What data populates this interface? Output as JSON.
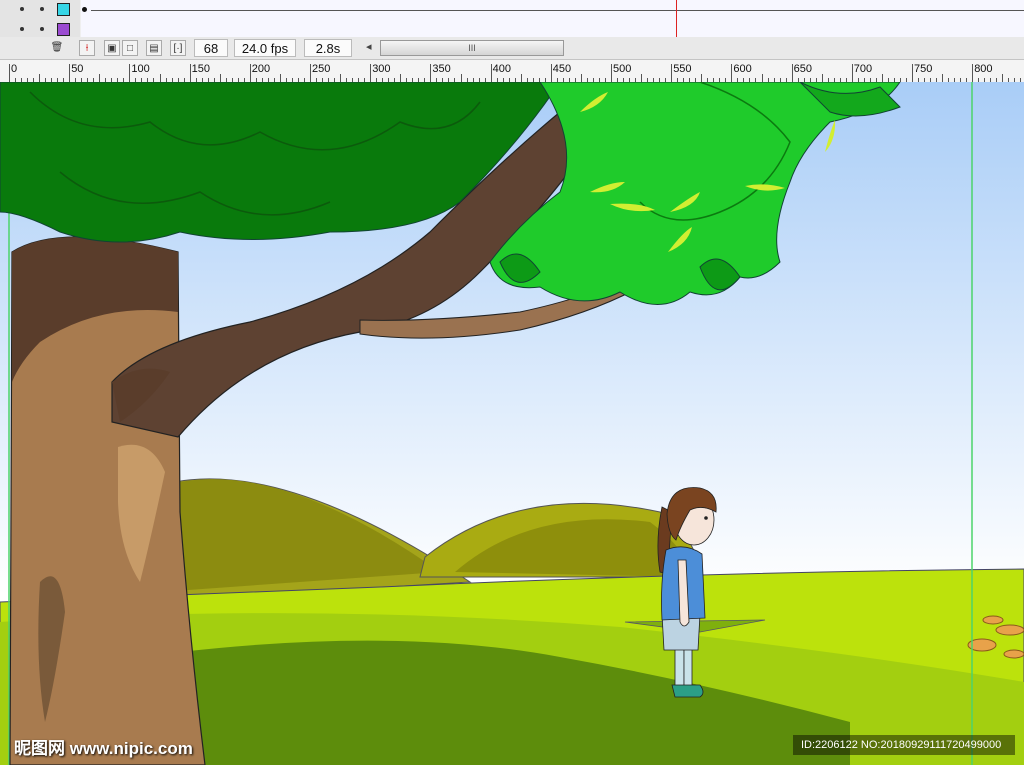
{
  "timeline": {
    "layers": [
      {
        "swatch_color": "#37d6e6"
      },
      {
        "swatch_color": "#9b4bd1"
      }
    ],
    "playhead_color": "#d22222"
  },
  "toolbar": {
    "current_frame": "68",
    "frame_rate": "24.0 fps",
    "elapsed_time": "2.8s",
    "scroll_grip": "III",
    "scroll_left_arrow": "◂"
  },
  "ruler": {
    "labels": [
      "0",
      "50",
      "100",
      "150",
      "200",
      "250",
      "300",
      "350",
      "400",
      "450",
      "500",
      "550",
      "600",
      "650",
      "700",
      "750",
      "800"
    ]
  },
  "watermark": {
    "site_name": "昵图网 www.nipic.com",
    "image_info": "ID:2206122 NO:20180929111720499000"
  }
}
